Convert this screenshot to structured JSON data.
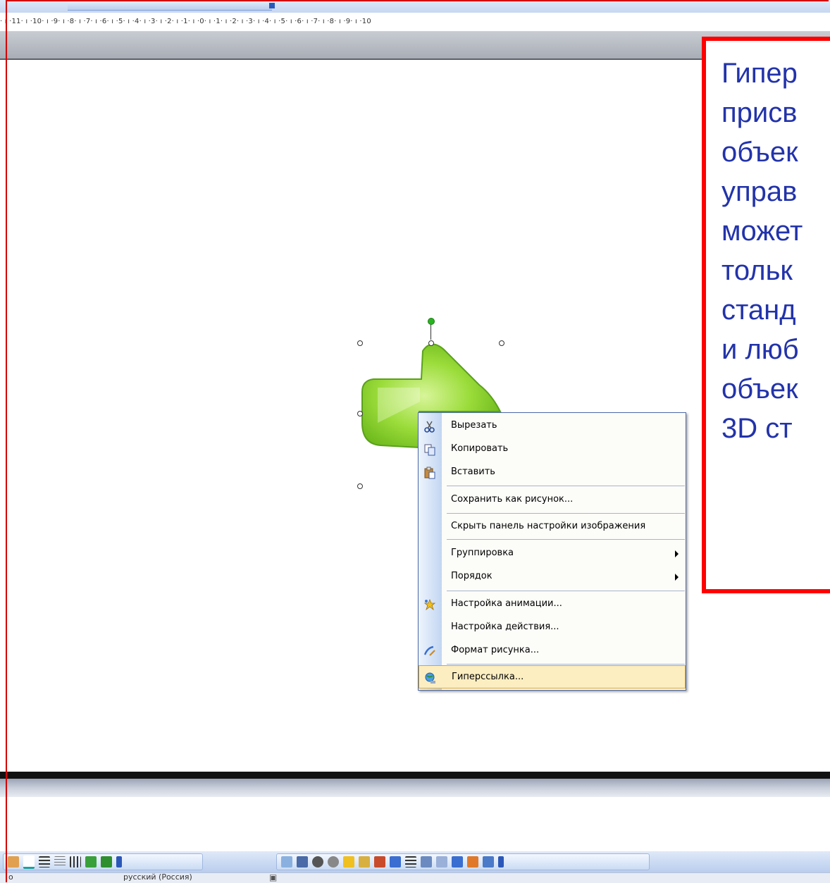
{
  "ruler": {
    "text": "· ı ·11· ı ·10· ı ·9· ı ·8· ı ·7· ı ·6· ı ·5· ı ·4· ı ·3· ı ·2· ı ·1· ı ·0· ı ·1· ı ·2· ı ·3· ı ·4· ı ·5· ı ·6· ı ·7· ı ·8· ı ·9· ı ·10"
  },
  "callout": {
    "lines": [
      "Гипер",
      "присв",
      "объек",
      "управ",
      "может",
      "тольк",
      "станд",
      "и люб",
      "объек",
      "3D ст"
    ]
  },
  "context_menu": {
    "items": [
      {
        "label": "Вырезать",
        "icon": "scissors-icon"
      },
      {
        "label": "Копировать",
        "icon": "copy-icon"
      },
      {
        "label": "Вставить",
        "icon": "paste-icon"
      },
      {
        "label": "Сохранить как рисунок..."
      },
      {
        "label": "Скрыть панель настройки изображения"
      },
      {
        "label": "Группировка",
        "submenu": true
      },
      {
        "label": "Порядок",
        "submenu": true
      },
      {
        "label": "Настройка анимации...",
        "icon": "animation-icon"
      },
      {
        "label": "Настройка действия..."
      },
      {
        "label": "Формат рисунка...",
        "icon": "format-picture-icon"
      },
      {
        "label": "Гиперссылка...",
        "icon": "hyperlink-icon",
        "selected": true
      }
    ]
  },
  "status_bar": {
    "left": "о",
    "language": "русский (Россия)"
  },
  "colors": {
    "callout_border": "#ff0000",
    "callout_text": "#2233aa",
    "shape_fill": "#8fd62c",
    "menu_selected": "#fdeec1"
  }
}
